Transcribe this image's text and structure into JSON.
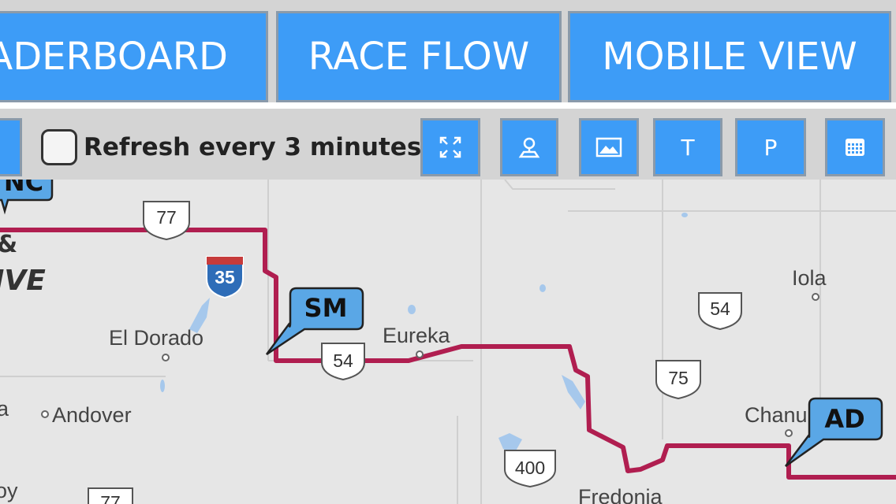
{
  "nav": {
    "leaderboard_label": "LEADERBOARD",
    "raceflow_label": "RACE FLOW",
    "mobile_label": "MOBILE VIEW"
  },
  "toolbar": {
    "refresh_label": "Refresh every 3 minutes",
    "refresh_checked": false,
    "buttons": [
      {
        "icon": "expand-icon"
      },
      {
        "icon": "location-pin-icon"
      },
      {
        "icon": "landscape-image-icon"
      },
      {
        "label": "T"
      },
      {
        "label": "P"
      },
      {
        "icon": "calendar-grid-icon"
      }
    ]
  },
  "map": {
    "cities": [
      "El Dorado",
      "Eureka",
      "Andover",
      "Iola",
      "Chanu",
      "Fredonia",
      "a",
      "oy"
    ],
    "highways": [
      "77",
      "35",
      "54",
      "54",
      "75",
      "400",
      "77"
    ],
    "markers": [
      "SM",
      "AD",
      "NC"
    ],
    "partial_label": "IVE",
    "colors": {
      "route": "#b01e50",
      "marker_fill": "#5aa7e6",
      "water": "#a6c8ec",
      "land": "#e6e6e6",
      "accent": "#3d9cf7"
    }
  }
}
